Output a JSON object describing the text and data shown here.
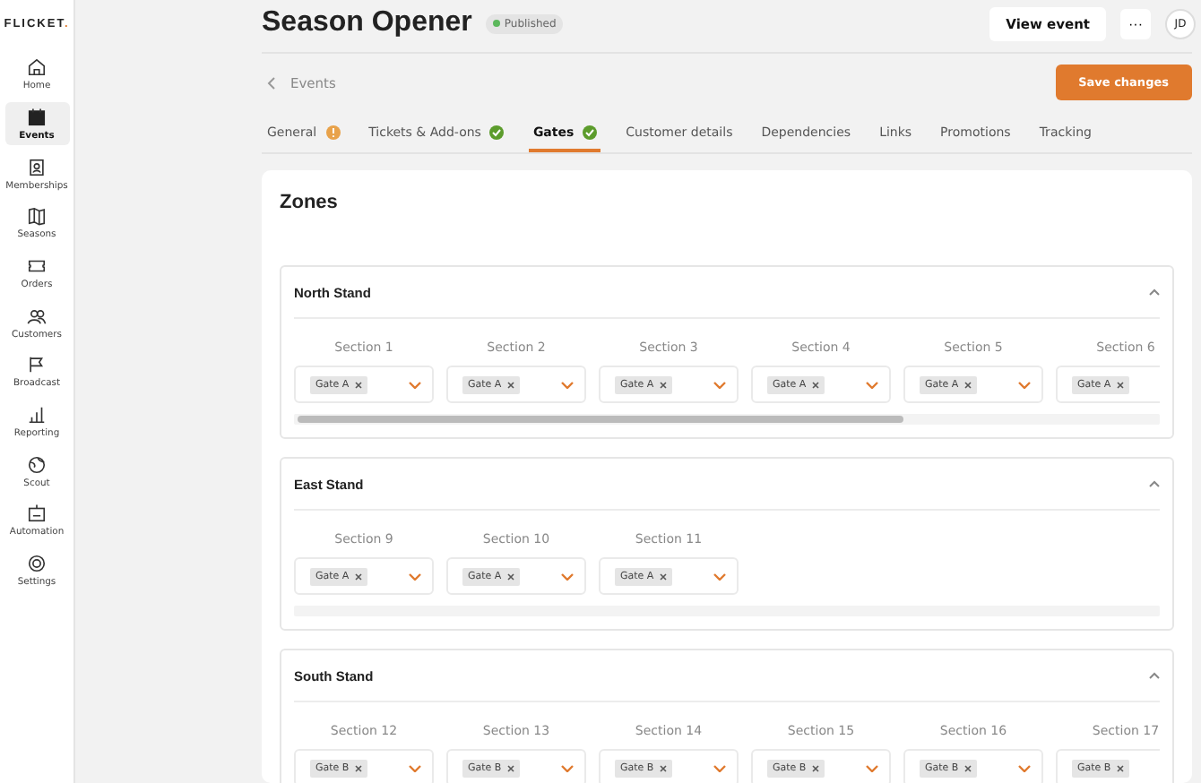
{
  "brand": {
    "name": "FLICKET",
    "dot": "."
  },
  "sidebar": {
    "items": [
      {
        "label": "Home",
        "selected": false
      },
      {
        "label": "Events",
        "selected": true
      },
      {
        "label": "Memberships",
        "selected": false
      },
      {
        "label": "Seasons",
        "selected": false
      },
      {
        "label": "Orders",
        "selected": false
      },
      {
        "label": "Customers",
        "selected": false
      },
      {
        "label": "Broadcast",
        "selected": false
      },
      {
        "label": "Reporting",
        "selected": false
      },
      {
        "label": "Scout",
        "selected": false
      },
      {
        "label": "Automation",
        "selected": false
      },
      {
        "label": "Settings",
        "selected": false
      }
    ]
  },
  "header": {
    "title": "Season Opener",
    "status_badge": "Published",
    "view_button": "View event",
    "more_button": "···",
    "avatar": "JD"
  },
  "breadcrumb": {
    "label": "Events"
  },
  "save_button": "Save changes",
  "tabs": [
    {
      "label": "General",
      "selected": false,
      "kind": "warning"
    },
    {
      "label": "Tickets & Add-ons",
      "selected": false,
      "kind": "complete"
    },
    {
      "label": "Gates",
      "selected": true,
      "kind": "complete"
    },
    {
      "label": "Customer details",
      "selected": false,
      "kind": "plain"
    },
    {
      "label": "Dependencies",
      "selected": false,
      "kind": "plain"
    },
    {
      "label": "Links",
      "selected": false,
      "kind": "plain"
    },
    {
      "label": "Promotions",
      "selected": false,
      "kind": "plain"
    },
    {
      "label": "Tracking",
      "selected": false,
      "kind": "plain"
    }
  ],
  "zones": {
    "title": "Zones",
    "stands": [
      {
        "name": "North Stand",
        "expanded": true,
        "scrollable": true,
        "sections": [
          {
            "label": "Section 1",
            "gate": "Gate A"
          },
          {
            "label": "Section 2",
            "gate": "Gate A"
          },
          {
            "label": "Section 3",
            "gate": "Gate A"
          },
          {
            "label": "Section 4",
            "gate": "Gate A"
          },
          {
            "label": "Section 5",
            "gate": "Gate A"
          },
          {
            "label": "Section 6",
            "gate": "Gate A"
          }
        ]
      },
      {
        "name": "East Stand",
        "expanded": true,
        "scrollable": false,
        "sections": [
          {
            "label": "Section 9",
            "gate": "Gate A"
          },
          {
            "label": "Section 10",
            "gate": "Gate A"
          },
          {
            "label": "Section 11",
            "gate": "Gate A"
          }
        ]
      },
      {
        "name": "South Stand",
        "expanded": true,
        "sections": [
          {
            "label": "Section 12",
            "gate": "Gate B"
          },
          {
            "label": "Section 13",
            "gate": "Gate B"
          },
          {
            "label": "Section 14",
            "gate": "Gate B"
          },
          {
            "label": "Section 15",
            "gate": "Gate B"
          },
          {
            "label": "Section 16",
            "gate": "Gate B"
          },
          {
            "label": "Section 17",
            "gate": "Gate B"
          }
        ]
      }
    ]
  }
}
